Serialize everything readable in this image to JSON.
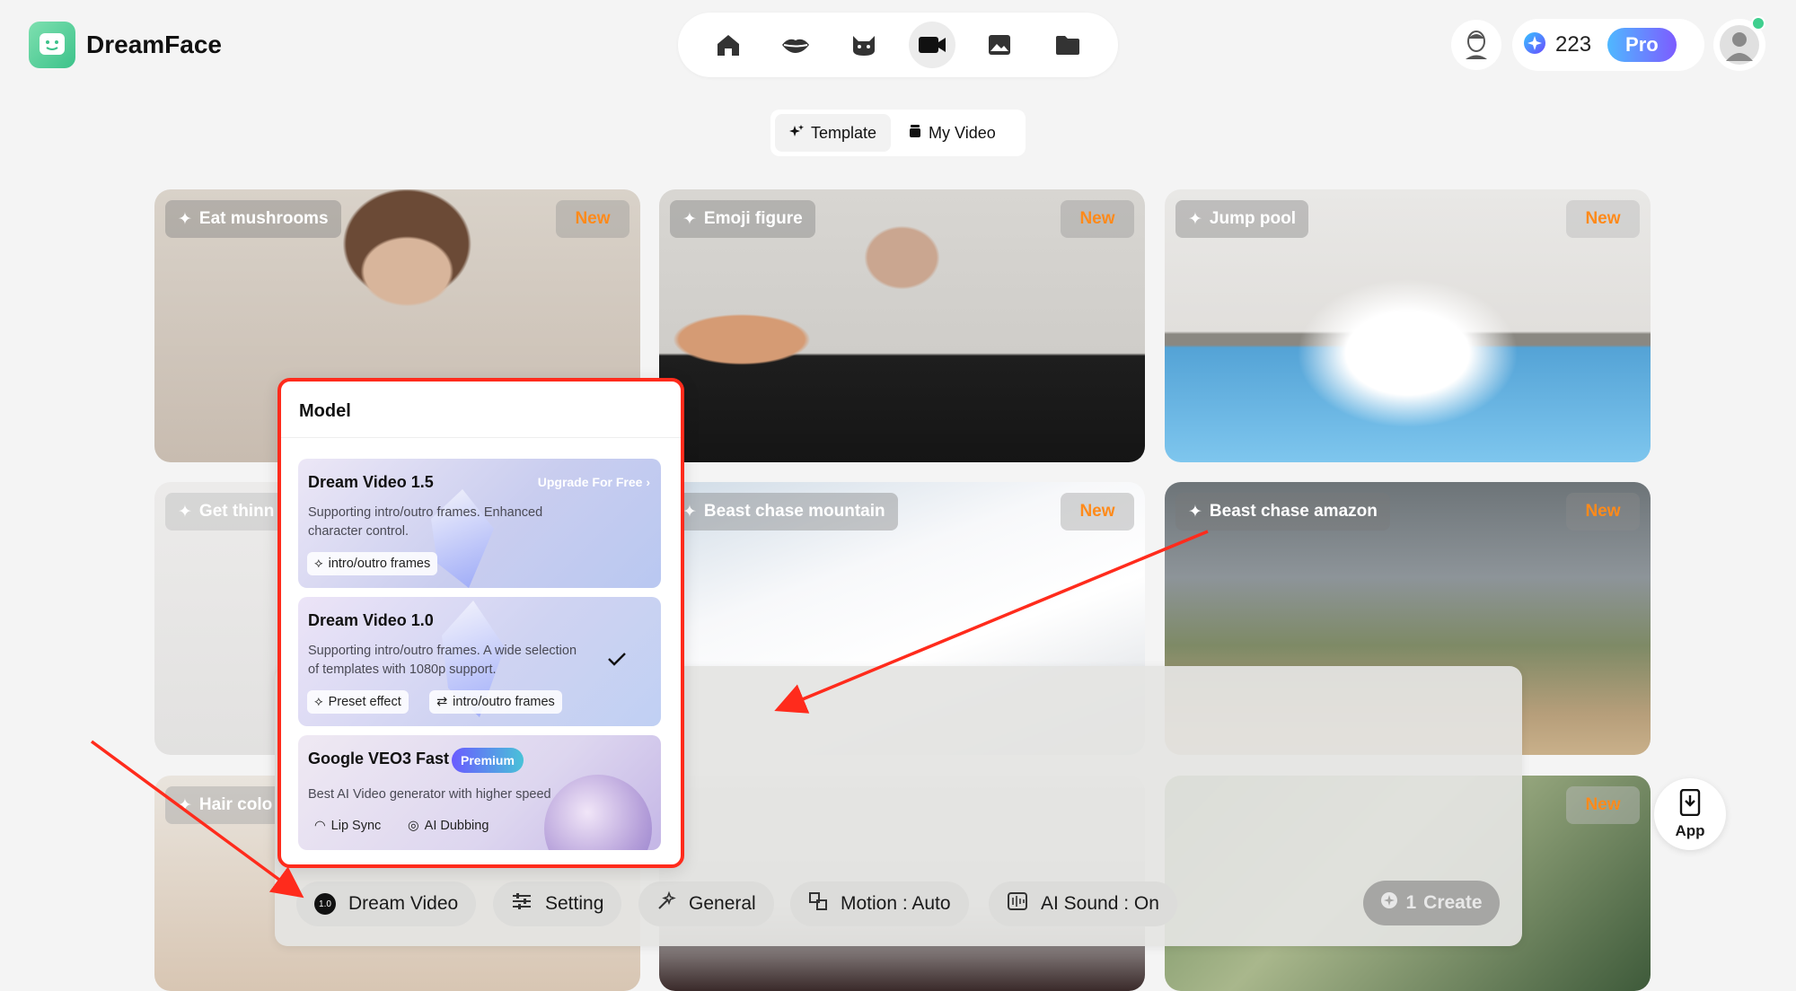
{
  "header": {
    "logo_text": "DreamFace",
    "credits": "223",
    "pro_label": "Pro"
  },
  "nav": {
    "items": [
      "home-icon",
      "lips-icon",
      "cat-icon",
      "video-camera-icon",
      "image-icon",
      "folder-icon"
    ],
    "active": "video-camera-icon"
  },
  "tabs": [
    {
      "label": "Template"
    },
    {
      "label": "My Video"
    }
  ],
  "cards": [
    {
      "tag": "Eat mushrooms",
      "badge": "New"
    },
    {
      "tag": "Emoji figure",
      "badge": "New"
    },
    {
      "tag": "Jump pool",
      "badge": "New"
    },
    {
      "tag": "Get thinn"
    },
    {
      "tag": "Beast chase mountain",
      "badge": "New"
    },
    {
      "tag": "Beast chase amazon",
      "badge": "New"
    },
    {
      "tag": "Hair colo"
    },
    {
      "badge": "New"
    }
  ],
  "model_popup": {
    "title": "Model",
    "models": [
      {
        "name": "Dream Video 1.5",
        "upgrade": "Upgrade For Free",
        "desc": "Supporting intro/outro frames. Enhanced character control.",
        "chips": [
          "intro/outro frames"
        ]
      },
      {
        "name": "Dream Video 1.0",
        "desc": "Supporting intro/outro frames. A wide selection of templates with 1080p support.",
        "chips": [
          "Preset effect",
          "intro/outro frames"
        ],
        "selected": true
      },
      {
        "name": "Google VEO3 Fast",
        "badge": "Premium",
        "desc": "Best AI Video generator with higher speed",
        "chips": [
          "Lip Sync",
          "AI Dubbing"
        ]
      }
    ]
  },
  "prompt": {
    "placeholder_fragment": "on",
    "toolbar": {
      "model_badge": "1.0",
      "model_label": "Dream Video",
      "setting_label": "Setting",
      "general_label": "General",
      "motion_label": "Motion : Auto",
      "sound_label": "AI Sound : On",
      "create_cost": "1",
      "create_label": "Create"
    }
  },
  "app_button": {
    "label": "App"
  },
  "colors": {
    "accent": "#ff2b1c",
    "new_badge": "#ff8a1a",
    "pro_start": "#4fb8ff",
    "pro_end": "#7d5cff"
  }
}
